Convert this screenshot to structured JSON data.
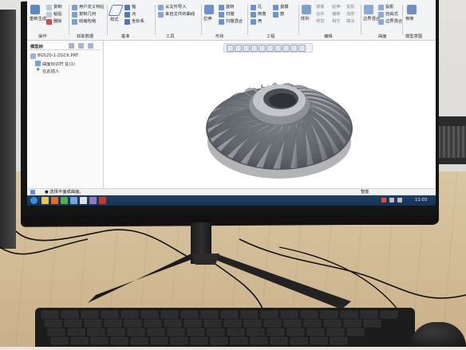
{
  "ribbon": {
    "row1": [
      "复制",
      "用户定义特征",
      "轴",
      "从文件导入",
      "倒角",
      "孔",
      "拔模",
      "阵列",
      "镜像",
      "延伸",
      "投影",
      "填充",
      "偏移",
      "相交",
      "实体化",
      "扭曲",
      "包络",
      "加厚"
    ],
    "small_items": [
      "粘贴",
      "删除",
      "重新生成",
      "复制几何",
      "收缩包络",
      "点",
      "坐标系",
      "来自文件的曲线",
      "扫描",
      "拉伸",
      "旋转",
      "扫描混合",
      "壳",
      "筋",
      "修剪",
      "合并",
      "骨架",
      "草绘",
      "样式",
      "自由式",
      "边界混合"
    ],
    "groups": [
      "操作",
      "获取数据",
      "基准",
      "工具",
      "形状",
      "工程",
      "编辑",
      "曲面",
      "模型意图"
    ]
  },
  "tree": {
    "tab_label": "模型树",
    "file_name": "BG520-1-ZGCK.PRT",
    "items": [
      "曲面标识符 征(1)",
      "在此插入"
    ]
  },
  "status": {
    "text": "● 选择平面或曲面。"
  },
  "taskbar": {
    "filter": "智能",
    "clock": "11:03"
  }
}
